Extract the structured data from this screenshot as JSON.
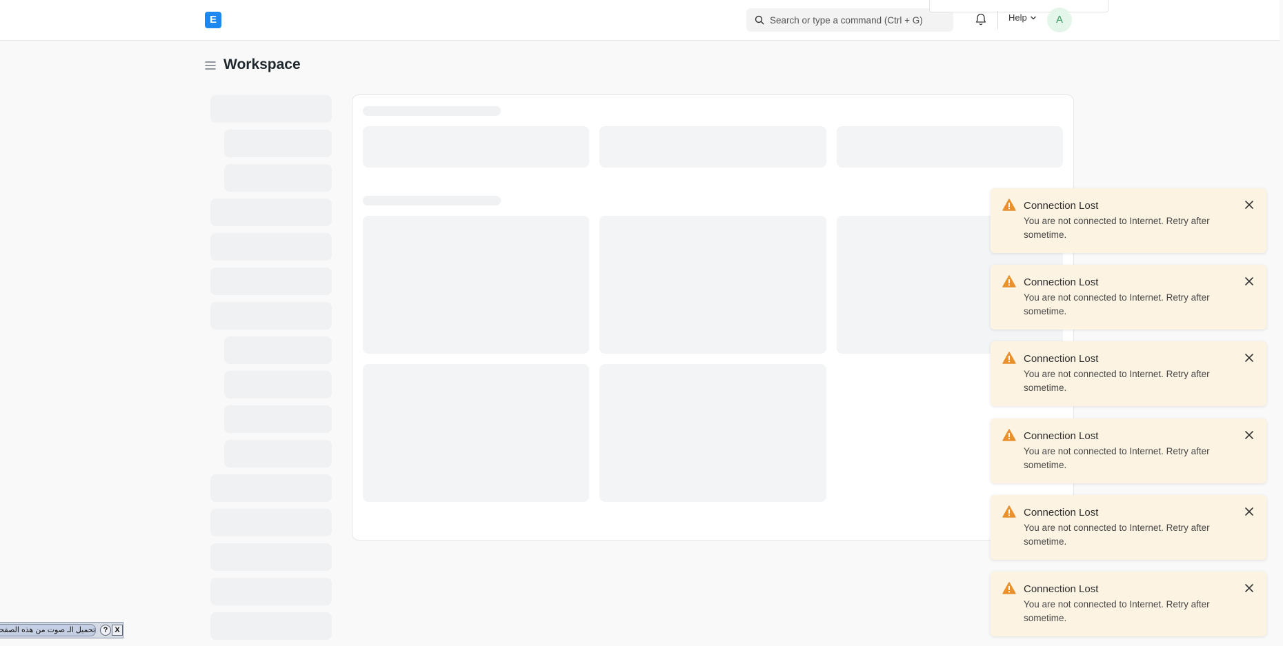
{
  "navbar": {
    "logo_text": "E",
    "search_placeholder": "Search or type a command (Ctrl + G)",
    "help_label": "Help",
    "avatar_initial": "A"
  },
  "page": {
    "title": "Workspace"
  },
  "toasts": [
    {
      "title": "Connection Lost",
      "message": "You are not connected to Internet. Retry after sometime."
    },
    {
      "title": "Connection Lost",
      "message": "You are not connected to Internet. Retry after sometime."
    },
    {
      "title": "Connection Lost",
      "message": "You are not connected to Internet. Retry after sometime."
    },
    {
      "title": "Connection Lost",
      "message": "You are not connected to Internet. Retry after sometime."
    },
    {
      "title": "Connection Lost",
      "message": "You are not connected to Internet. Retry after sometime."
    },
    {
      "title": "Connection Lost",
      "message": "You are not connected to Internet. Retry after sometime."
    }
  ],
  "tts_widget": {
    "label": "تحميل الـ صوت من هذه الصفحة",
    "help_glyph": "?",
    "close_glyph": "X"
  },
  "colors": {
    "brand": "#1e88f0",
    "toast_bg": "#fdf3e2",
    "warning": "#e8912d"
  },
  "icons": [
    "search-icon",
    "bell-icon",
    "chevron-down-icon",
    "hamburger-icon",
    "warning-icon",
    "close-icon"
  ]
}
